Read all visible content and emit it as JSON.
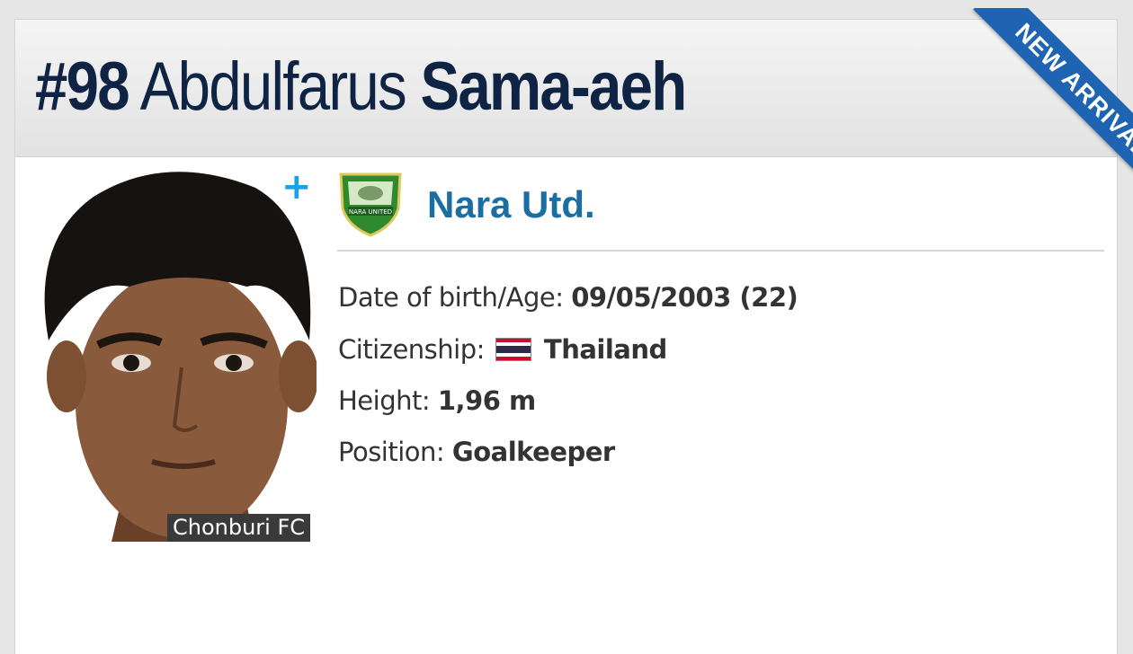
{
  "header": {
    "number": "#98",
    "first_name": "Abdulfarus",
    "last_name": "Sama-aeh"
  },
  "ribbon": {
    "label": "NEW ARRIVAL",
    "color": "#1f63b3"
  },
  "photo": {
    "caption": "Chonburi FC",
    "add_icon": "plus-icon"
  },
  "club": {
    "name": "Nara Utd.",
    "logo_icon": "club-crest-icon",
    "logo_text": "NARA UNITED",
    "name_color": "#1b6ea1"
  },
  "details": {
    "dob_label": "Date of birth/Age:",
    "dob_value": "09/05/2003 (22)",
    "citizenship_label": "Citizenship:",
    "citizenship_flag": "thailand-flag-icon",
    "citizenship_value": "Thailand",
    "height_label": "Height:",
    "height_value": "1,96 m",
    "position_label": "Position:",
    "position_value": "Goalkeeper"
  },
  "colors": {
    "title": "#0f2344",
    "accent_plus": "#1aa1e6"
  }
}
